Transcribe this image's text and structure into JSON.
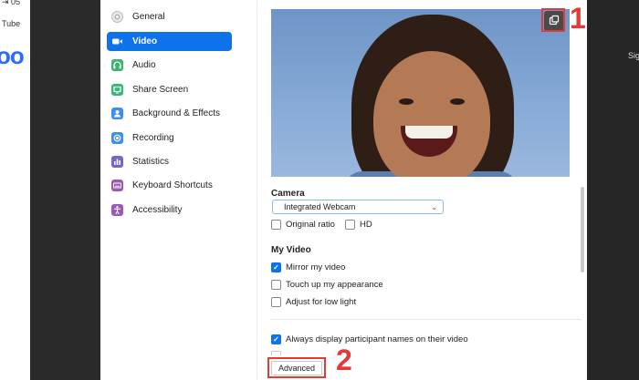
{
  "background": {
    "tab_number": "⇥ 05",
    "tab_text": "Tube",
    "logo_text": "oo",
    "right_text": "Sig"
  },
  "sidebar": {
    "items": [
      {
        "label": "General",
        "icon": "gear-icon",
        "color": "#dcdcdc",
        "active": false
      },
      {
        "label": "Video",
        "icon": "video-camera-icon",
        "color": "#ffffff",
        "active": true
      },
      {
        "label": "Audio",
        "icon": "headphones-icon",
        "color": "#3cb371",
        "active": false
      },
      {
        "label": "Share Screen",
        "icon": "share-screen-icon",
        "color": "#35b87a",
        "active": false
      },
      {
        "label": "Background & Effects",
        "icon": "portrait-icon",
        "color": "#3f8fe8",
        "active": false
      },
      {
        "label": "Recording",
        "icon": "record-icon",
        "color": "#3f8fe8",
        "active": false
      },
      {
        "label": "Statistics",
        "icon": "bar-chart-icon",
        "color": "#7a63c9",
        "active": false
      },
      {
        "label": "Keyboard Shortcuts",
        "icon": "keyboard-icon",
        "color": "#9b59b6",
        "active": false
      },
      {
        "label": "Accessibility",
        "icon": "accessibility-icon",
        "color": "#9b59b6",
        "active": false
      }
    ]
  },
  "content": {
    "camera_title": "Camera",
    "camera_value": "Integrated Webcam",
    "original_ratio_label": "Original ratio",
    "original_ratio_checked": false,
    "hd_label": "HD",
    "hd_checked": false,
    "my_video_title": "My Video",
    "mirror_label": "Mirror my video",
    "mirror_checked": true,
    "touch_up_label": "Touch up my appearance",
    "touch_up_checked": false,
    "low_light_label": "Adjust for low light",
    "low_light_checked": false,
    "names_label": "Always display participant names on their video",
    "names_checked": true,
    "advanced_label": "Advanced"
  },
  "annotations": {
    "marker_1": "1",
    "marker_2": "2"
  },
  "colors": {
    "accent": "#0e72ed",
    "annotation_red": "#e53935"
  }
}
